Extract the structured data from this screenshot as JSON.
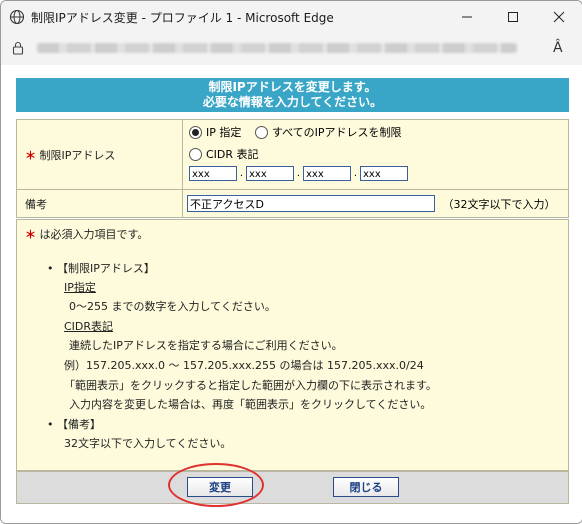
{
  "window": {
    "title": "制限IPアドレス変更 - プロファイル 1 - Microsoft Edge",
    "minimize_icon": "minimize-icon",
    "maximize_icon": "maximize-icon",
    "close_icon": "close-icon"
  },
  "addressbar": {
    "lock_icon": "lock-icon",
    "read_aloud": "Â"
  },
  "header": {
    "line1": "制限IPアドレスを変更します。",
    "line2": "必要な情報を入力してください。"
  },
  "form": {
    "required_mark": "＊",
    "ip_label": "制限IPアドレス",
    "radio_ip": "IP 指定",
    "radio_all": "すべてのIPアドレスを制限",
    "radio_cidr": "CIDR 表記",
    "ip_selected": "IP 指定",
    "octets": [
      "xxx",
      "xxx",
      "xxx",
      "xxx"
    ],
    "octet_separator": ".",
    "memo_label": "備考",
    "memo_value": "不正アクセスD",
    "memo_hint": "（32文字以下で入力）"
  },
  "notes": {
    "required_mark": "＊",
    "required_text": "は必須入力項目です。",
    "bullet": "•",
    "section_ip": "【制限IPアドレス】",
    "ip_spec_title": "IP指定",
    "ip_spec_desc": "0～255 までの数字を入力してください。",
    "cidr_title": "CIDR表記",
    "cidr_desc1": "連続したIPアドレスを指定する場合にご利用ください。",
    "cidr_desc2": "例）157.205.xxx.0 ～ 157.205.xxx.255 の場合は 157.205.xxx.0/24",
    "cidr_desc3": "「範囲表示」をクリックすると指定した範囲が入力欄の下に表示されます。",
    "cidr_desc4": "入力内容を変更した場合は、再度「範囲表示」をクリックしてください。",
    "section_memo": "【備考】",
    "memo_desc": "32文字以下で入力してください。"
  },
  "buttons": {
    "change": "変更",
    "close": "閉じる"
  }
}
